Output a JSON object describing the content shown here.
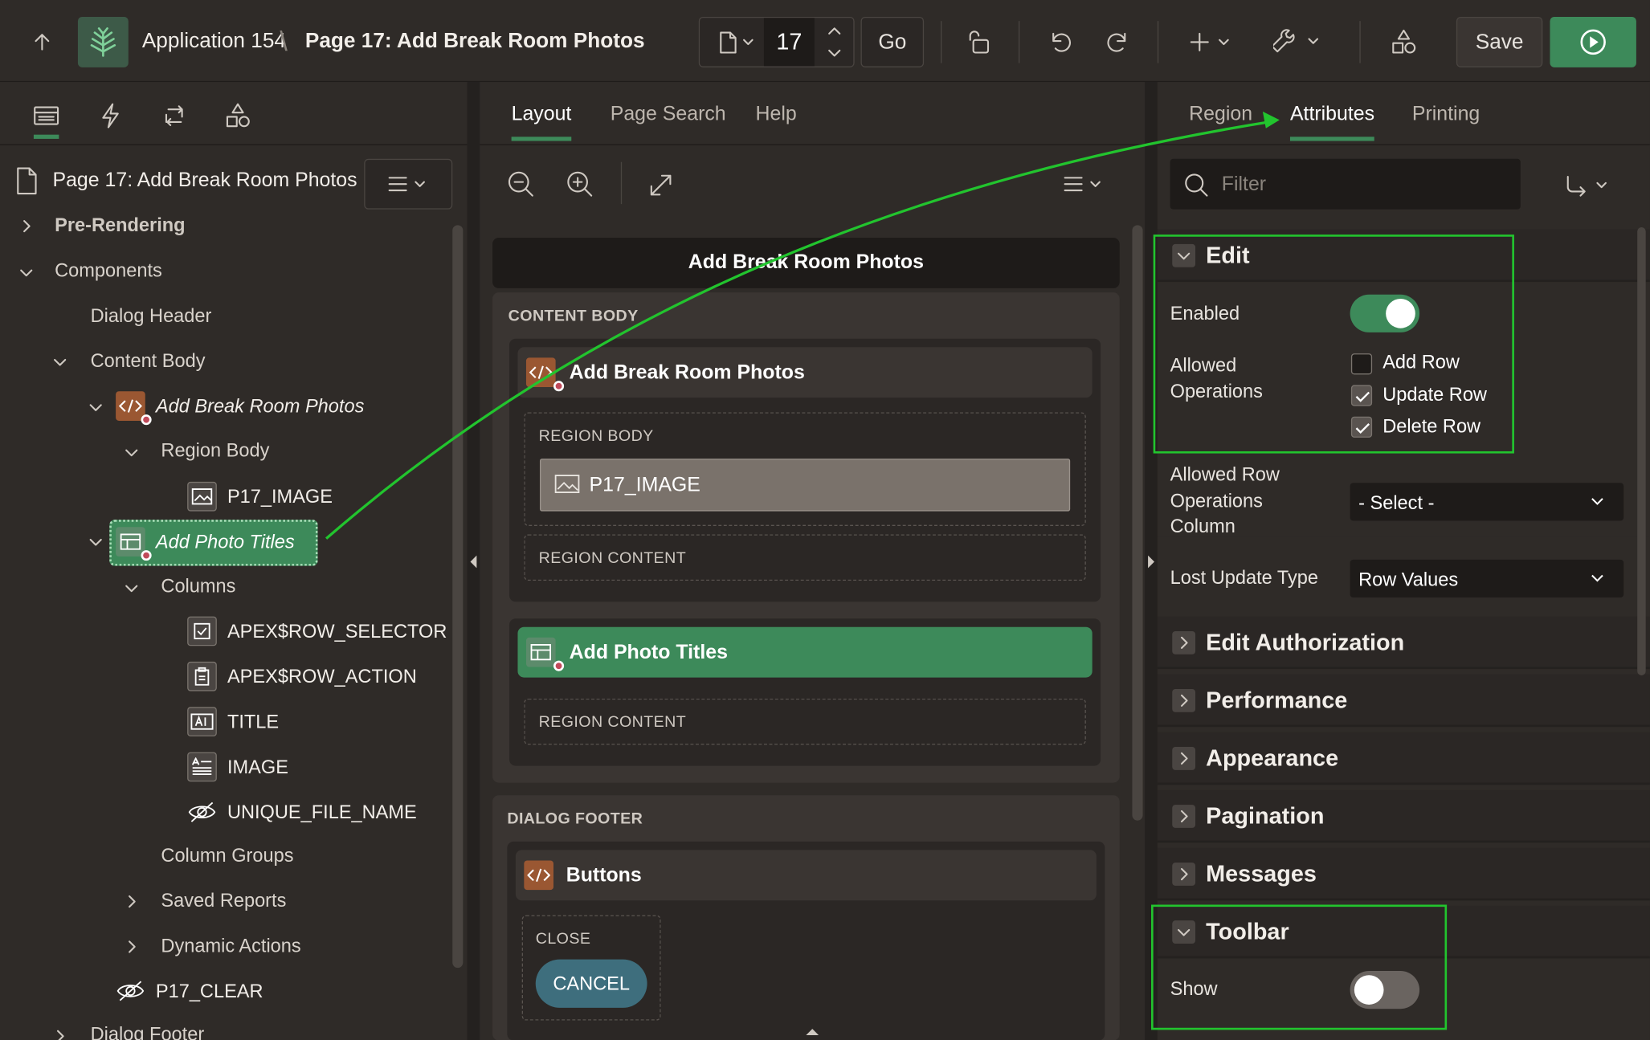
{
  "header": {
    "app_name": "Application 154",
    "separator": "\\",
    "page_title": "Page 17: Add Break Room Photos",
    "page_number": "17",
    "go_label": "Go",
    "save_label": "Save"
  },
  "left": {
    "tabs": [
      "rendering",
      "dynamic-actions",
      "processing",
      "shared-components"
    ],
    "page_node": "Page 17: Add Break Room Photos",
    "tree": {
      "pre_rendering": "Pre-Rendering",
      "components": "Components",
      "dialog_header": "Dialog Header",
      "content_body": "Content Body",
      "region_static": "Add Break Room Photos",
      "region_body": "Region Body",
      "p17_image": "P17_IMAGE",
      "region_ig": "Add Photo Titles",
      "columns": "Columns",
      "col_selector": "APEX$ROW_SELECTOR",
      "col_action": "APEX$ROW_ACTION",
      "col_title": "TITLE",
      "col_image": "IMAGE",
      "col_unique": "UNIQUE_FILE_NAME",
      "column_groups": "Column Groups",
      "saved_reports": "Saved Reports",
      "dynamic_actions": "Dynamic Actions",
      "p17_clear": "P17_CLEAR",
      "dialog_footer": "Dialog Footer"
    }
  },
  "mid": {
    "tabs": [
      "Layout",
      "Page Search",
      "Help"
    ],
    "page_header": "Add Break Room Photos",
    "content_body": "CONTENT BODY",
    "region1_title": "Add Break Room Photos",
    "region_body": "REGION BODY",
    "item": "P17_IMAGE",
    "region_content": "REGION CONTENT",
    "region2_title": "Add Photo Titles",
    "region_content2": "REGION CONTENT",
    "dialog_footer": "DIALOG FOOTER",
    "buttons_title": "Buttons",
    "close_label": "CLOSE",
    "cancel_label": "CANCEL"
  },
  "right": {
    "tabs": [
      "Region",
      "Attributes",
      "Printing"
    ],
    "filter_placeholder": "Filter",
    "edit": {
      "title": "Edit",
      "enabled_label": "Enabled",
      "enabled": true,
      "allowed_ops_label": [
        "Allowed",
        "Operations"
      ],
      "ops": [
        {
          "label": "Add Row",
          "checked": false
        },
        {
          "label": "Update Row",
          "checked": true
        },
        {
          "label": "Delete Row",
          "checked": true
        }
      ],
      "ops_col_label": [
        "Allowed Row",
        "Operations",
        "Column"
      ],
      "ops_col_value": "- Select -",
      "lost_update_label": "Lost Update Type",
      "lost_update_value": "Row Values"
    },
    "sections": [
      "Edit Authorization",
      "Performance",
      "Appearance",
      "Pagination",
      "Messages"
    ],
    "toolbar": {
      "title": "Toolbar",
      "show_label": "Show",
      "show": false
    }
  },
  "colors": {
    "accent": "#3d8a5a",
    "highlight": "#22c42e",
    "code_icon": "#9a5732",
    "cancel_button": "#3e6e7d"
  }
}
